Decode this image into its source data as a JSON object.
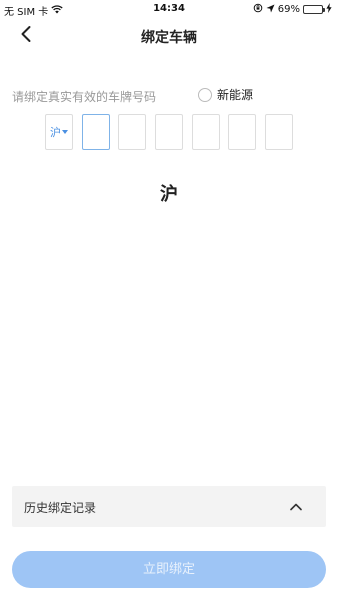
{
  "status_bar": {
    "carrier": "无 SIM 卡",
    "time": "14:34",
    "battery_percent": "69%",
    "battery_level": 0.69,
    "icons": [
      "wifi-icon",
      "orientation-lock-icon",
      "location-icon",
      "battery-icon",
      "charging-icon"
    ]
  },
  "nav": {
    "title": "绑定车辆",
    "back_icon": "chevron-left-icon"
  },
  "form": {
    "hint": "请绑定真实有效的车牌号码",
    "new_energy_label": "新能源",
    "new_energy_checked": false,
    "province": "沪",
    "plate_chars": [
      "",
      "",
      "",
      "",
      "",
      ""
    ]
  },
  "preview": {
    "char": "沪"
  },
  "history": {
    "label": "历史绑定记录",
    "icon": "chevron-up-icon"
  },
  "actions": {
    "bind_label": "立即绑定"
  },
  "colors": {
    "accent": "#4a90e2",
    "button_disabled": "#9ec5f5",
    "history_bg": "#f3f3f3"
  }
}
